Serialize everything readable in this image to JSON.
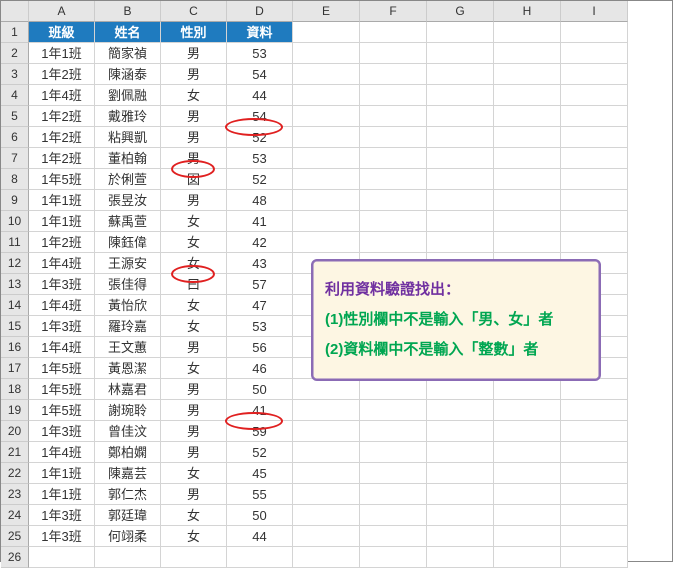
{
  "columns": [
    "A",
    "B",
    "C",
    "D",
    "E",
    "F",
    "G",
    "H",
    "I"
  ],
  "rowNumbers": [
    1,
    2,
    3,
    4,
    5,
    6,
    7,
    8,
    9,
    10,
    11,
    12,
    13,
    14,
    15,
    16,
    17,
    18,
    19,
    20,
    21,
    22,
    23,
    24,
    25,
    26
  ],
  "headers": {
    "A": "班級",
    "B": "姓名",
    "C": "性別",
    "D": "資料"
  },
  "rows": [
    {
      "A": "1年1班",
      "B": "簡家禎",
      "C": "男",
      "D": "53"
    },
    {
      "A": "1年2班",
      "B": "陳涵泰",
      "C": "男",
      "D": "54"
    },
    {
      "A": "1年4班",
      "B": "劉佩融",
      "C": "女",
      "D": "44"
    },
    {
      "A": "1年2班",
      "B": "戴雅玲",
      "C": "男",
      "D": "54"
    },
    {
      "A": "1年2班",
      "B": "粘興凱",
      "C": "男",
      "D": "52"
    },
    {
      "A": "1年2班",
      "B": "董柏翰",
      "C": "男",
      "D": "53"
    },
    {
      "A": "1年5班",
      "B": "於俐萱",
      "C": "囡",
      "D": "52"
    },
    {
      "A": "1年1班",
      "B": "張昱汝",
      "C": "男",
      "D": "48"
    },
    {
      "A": "1年1班",
      "B": "蘇禹萱",
      "C": "女",
      "D": "41"
    },
    {
      "A": "1年2班",
      "B": "陳鈺偉",
      "C": "女",
      "D": "42"
    },
    {
      "A": "1年4班",
      "B": "王源安",
      "C": "女",
      "D": "43"
    },
    {
      "A": "1年3班",
      "B": "張佳得",
      "C": "曰",
      "D": "57"
    },
    {
      "A": "1年4班",
      "B": "黃怡欣",
      "C": "女",
      "D": "47"
    },
    {
      "A": "1年3班",
      "B": "羅玲嘉",
      "C": "女",
      "D": "53"
    },
    {
      "A": "1年4班",
      "B": "王文蕙",
      "C": "男",
      "D": "56"
    },
    {
      "A": "1年5班",
      "B": "黃恩潔",
      "C": "女",
      "D": "46"
    },
    {
      "A": "1年5班",
      "B": "林嘉君",
      "C": "男",
      "D": "50"
    },
    {
      "A": "1年5班",
      "B": "謝琬聆",
      "C": "男",
      "D": "41"
    },
    {
      "A": "1年3班",
      "B": "曾佳汶",
      "C": "男",
      "D": "59"
    },
    {
      "A": "1年4班",
      "B": "鄭柏嫻",
      "C": "男",
      "D": "52"
    },
    {
      "A": "1年1班",
      "B": "陳嘉芸",
      "C": "女",
      "D": "45"
    },
    {
      "A": "1年1班",
      "B": "郭仁杰",
      "C": "男",
      "D": "55"
    },
    {
      "A": "1年3班",
      "B": "郭廷瑋",
      "C": "女",
      "D": "50"
    },
    {
      "A": "1年3班",
      "B": "何翊柔",
      "C": "女",
      "D": "44"
    }
  ],
  "callout": {
    "line1": "利用資料驗證找出：",
    "line2": "(1)性別欄中不是輸入「男、女」者",
    "line3": "(2)資料欄中不是輸入「整數」者"
  },
  "chart_data": {
    "type": "table",
    "title": "",
    "columns": [
      "班級",
      "姓名",
      "性別",
      "資料"
    ],
    "data": [
      [
        "1年1班",
        "簡家禎",
        "男",
        53
      ],
      [
        "1年2班",
        "陳涵泰",
        "男",
        54
      ],
      [
        "1年4班",
        "劉佩融",
        "女",
        44
      ],
      [
        "1年2班",
        "戴雅玲",
        "男",
        54
      ],
      [
        "1年2班",
        "粘興凱",
        "男",
        52
      ],
      [
        "1年2班",
        "董柏翰",
        "男",
        53
      ],
      [
        "1年5班",
        "於俐萱",
        "囡",
        52
      ],
      [
        "1年1班",
        "張昱汝",
        "男",
        48
      ],
      [
        "1年1班",
        "蘇禹萱",
        "女",
        41
      ],
      [
        "1年2班",
        "陳鈺偉",
        "女",
        42
      ],
      [
        "1年4班",
        "王源安",
        "女",
        43
      ],
      [
        "1年3班",
        "張佳得",
        "曰",
        57
      ],
      [
        "1年4班",
        "黃怡欣",
        "女",
        47
      ],
      [
        "1年3班",
        "羅玲嘉",
        "女",
        53
      ],
      [
        "1年4班",
        "王文蕙",
        "男",
        56
      ],
      [
        "1年5班",
        "黃恩潔",
        "女",
        46
      ],
      [
        "1年5班",
        "林嘉君",
        "男",
        50
      ],
      [
        "1年5班",
        "謝琬聆",
        "男",
        41
      ],
      [
        "1年3班",
        "曾佳汶",
        "男",
        59
      ],
      [
        "1年4班",
        "鄭柏嫻",
        "男",
        52
      ],
      [
        "1年1班",
        "陳嘉芸",
        "女",
        45
      ],
      [
        "1年1班",
        "郭仁杰",
        "男",
        55
      ],
      [
        "1年3班",
        "郭廷瑋",
        "女",
        50
      ],
      [
        "1年3班",
        "何翊柔",
        "女",
        44
      ]
    ],
    "highlighted_cells": [
      {
        "row": 6,
        "column": "D",
        "reason": "non-integer in 資料"
      },
      {
        "row": 8,
        "column": "C",
        "reason": "invalid value in 性別"
      },
      {
        "row": 13,
        "column": "C",
        "reason": "invalid value in 性別"
      },
      {
        "row": 20,
        "column": "D",
        "reason": "non-integer in 資料"
      }
    ]
  }
}
